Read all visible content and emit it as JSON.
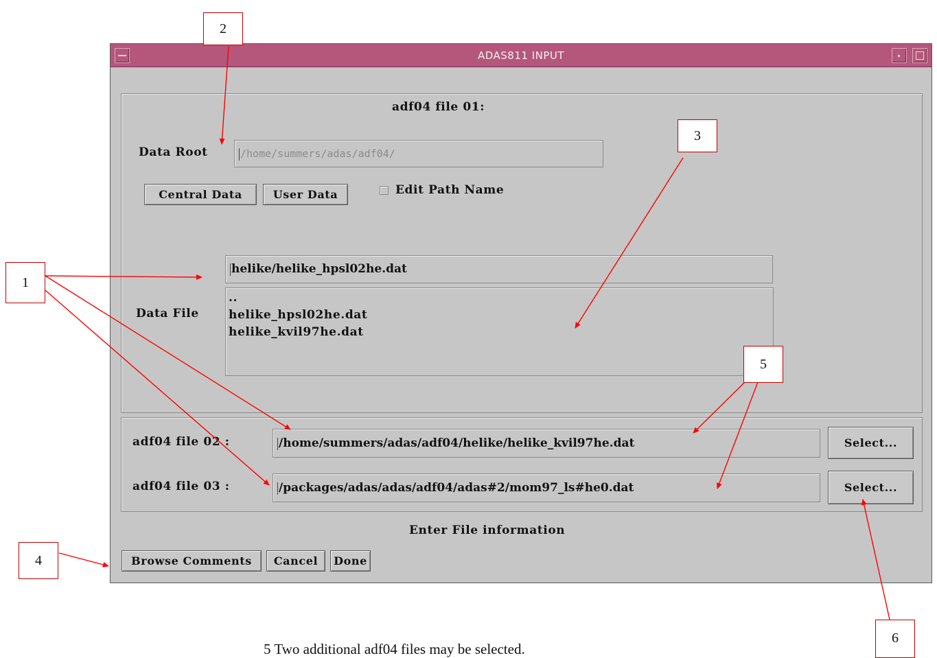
{
  "window": {
    "title": "ADAS811 INPUT"
  },
  "section01": {
    "heading": "adf04 file 01:",
    "data_root_label": "Data Root",
    "data_root_value": "/home/summers/adas/adf04/",
    "central_data_button": "Central Data",
    "user_data_button": "User Data",
    "edit_path_label": "Edit Path Name",
    "data_file_label": "Data File",
    "data_file_value": "helike/helike_hpsl02he.dat",
    "file_list": [
      "..",
      "helike_hpsl02he.dat",
      "helike_kvil97he.dat"
    ]
  },
  "section02": {
    "file02_label": "adf04 file 02 :",
    "file02_value": "/home/summers/adas/adf04/helike/helike_kvil97he.dat",
    "file03_label": "adf04 file 03 :",
    "file03_value": "/packages/adas/adas/adf04/adas#2/mom97_ls#he0.dat",
    "select_button": "Select..."
  },
  "status": "Enter File information",
  "buttons": {
    "browse": "Browse Comments",
    "cancel": "Cancel",
    "done": "Done"
  },
  "annotations": {
    "n1": "1",
    "n2": "2",
    "n3": "3",
    "n4": "4",
    "n5": "5",
    "n6": "6"
  },
  "caption": "5 Two additional adf04 files may be selected.",
  "colors": {
    "titlebar": "#b4577a",
    "panel": "#c6c6c6",
    "annotation": "#ff0000"
  }
}
